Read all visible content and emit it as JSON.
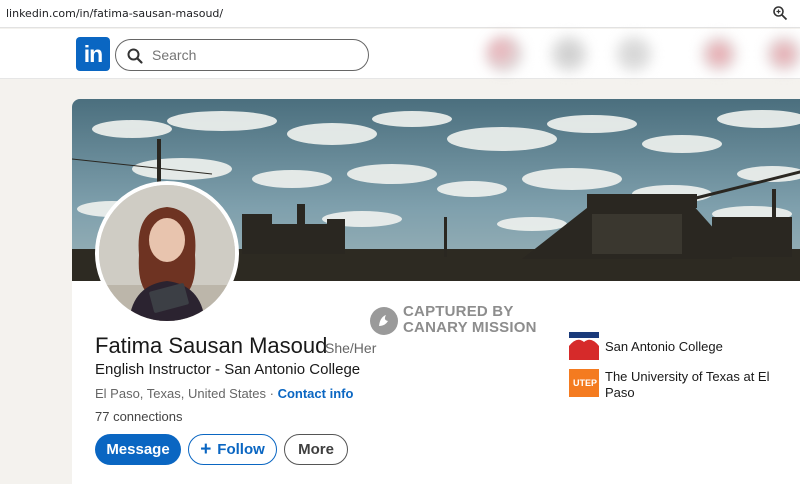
{
  "browser": {
    "url": "linkedin.com/in/fatima-sausan-masoud/"
  },
  "nav": {
    "logo_text": "in",
    "search_placeholder": "Search"
  },
  "profile": {
    "name": "Fatima Sausan Masoud",
    "pronouns": "She/Her",
    "headline": "English Instructor - San Antonio College",
    "location": "El Paso, Texas, United States · ",
    "contact_info": "Contact info",
    "connections": "77 connections"
  },
  "actions": {
    "message": "Message",
    "follow": "Follow",
    "follow_icon": "+",
    "more": "More"
  },
  "education": [
    {
      "name": "San Antonio College",
      "logo_color": "#d62a2a"
    },
    {
      "name_line1": "The University of Texas at El",
      "name_line2": "Paso",
      "logo_color": "#f47b20",
      "logo_text": "UTEP"
    }
  ],
  "watermark": {
    "line1": "CAPTURED BY",
    "line2": "CANARY MISSION"
  },
  "colors": {
    "brand": "#0a66c2",
    "page_bg": "#f4f2ee"
  }
}
